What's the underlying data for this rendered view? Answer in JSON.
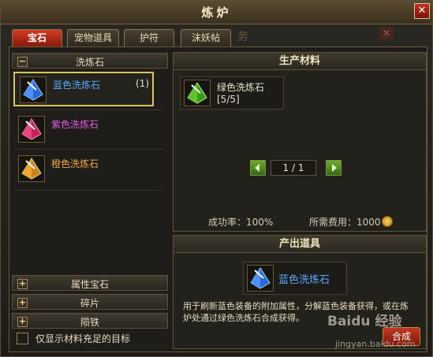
{
  "window": {
    "title": "炼炉"
  },
  "tabs": [
    {
      "label": "宝石",
      "active": true
    },
    {
      "label": "宠物道具",
      "active": false
    },
    {
      "label": "护符",
      "active": false
    },
    {
      "label": "沫妖帖",
      "active": false
    }
  ],
  "ghost_tab_text": "务",
  "left": {
    "category_open": {
      "label": "洗炼石",
      "toggle": "−"
    },
    "items": [
      {
        "name": "蓝色洗炼石",
        "count": "(1)",
        "color": "#5aa8ff",
        "gem": "blue"
      },
      {
        "name": "紫色洗炼石",
        "count": "",
        "color": "#e25be8",
        "gem": "magenta"
      },
      {
        "name": "橙色洗炼石",
        "count": "",
        "color": "#f0a840",
        "gem": "orange"
      }
    ],
    "categories_closed": [
      {
        "label": "属性宝石",
        "toggle": "+"
      },
      {
        "label": "碎片",
        "toggle": "+"
      },
      {
        "label": "陨铁",
        "toggle": "+"
      }
    ],
    "filter_checkbox_label": "仅显示材料充足的目标"
  },
  "materials": {
    "title": "生产材料",
    "item": {
      "name": "绿色洗炼石",
      "qty": "[5/5]",
      "gem": "green"
    },
    "page": "1 / 1",
    "success_rate": "成功率：100%",
    "cost": "所需费用：1000"
  },
  "output": {
    "title": "产出道具",
    "item": {
      "name": "蓝色洗炼石",
      "color": "#5aa8ff",
      "gem": "blue"
    },
    "description": "用于刷新蓝色装备的附加属性，分解蓝色装备获得，或在炼炉处通过绿色洗炼石合成获得。"
  },
  "buttons": {
    "craft": "合成"
  },
  "watermark": {
    "logo": "Baidu 经验",
    "url": "jingyan.baidu.com"
  },
  "colors": {
    "accent_red": "#c23a22",
    "selected_border": "#d8c55a",
    "gold": "#e9d6a0"
  }
}
